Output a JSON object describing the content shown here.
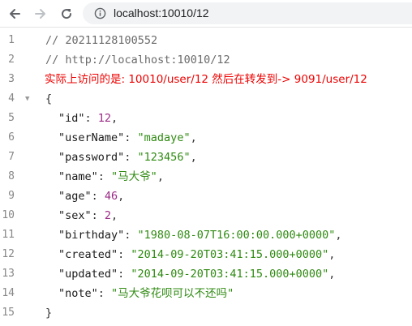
{
  "browser": {
    "url": "localhost:10010/12"
  },
  "code": {
    "line_numbers": [
      "1",
      "2",
      "3",
      "4",
      "5",
      "6",
      "7",
      "8",
      "9",
      "10",
      "11",
      "12",
      "13",
      "14",
      "15"
    ],
    "comment_1": "// 20211128100552",
    "comment_2": "// http://localhost:10010/12",
    "red_note": "实际上访问的是: 10010/user/12 然后在转发到-> 9091/user/12",
    "open_brace": "{",
    "close_brace": "}",
    "fields": [
      {
        "key": "\"id\"",
        "value": "12",
        "type": "number",
        "comma": ","
      },
      {
        "key": "\"userName\"",
        "value": "\"madaye\"",
        "type": "string",
        "comma": ","
      },
      {
        "key": "\"password\"",
        "value": "\"123456\"",
        "type": "string",
        "comma": ","
      },
      {
        "key": "\"name\"",
        "value": "\"马大爷\"",
        "type": "string",
        "comma": ","
      },
      {
        "key": "\"age\"",
        "value": "46",
        "type": "number",
        "comma": ","
      },
      {
        "key": "\"sex\"",
        "value": "2",
        "type": "number",
        "comma": ","
      },
      {
        "key": "\"birthday\"",
        "value": "\"1980-08-07T16:00:00.000+0000\"",
        "type": "string",
        "comma": ","
      },
      {
        "key": "\"created\"",
        "value": "\"2014-09-20T03:41:15.000+0000\"",
        "type": "string",
        "comma": ","
      },
      {
        "key": "\"updated\"",
        "value": "\"2014-09-20T03:41:15.000+0000\"",
        "type": "string",
        "comma": ","
      },
      {
        "key": "\"note\"",
        "value": "\"马大爷花呗可以不还吗\"",
        "type": "string",
        "comma": ""
      }
    ],
    "colon": ": "
  },
  "colors": {
    "comment": "#6b6b6b",
    "note_red": "#ee0000",
    "string": "#2f8a11",
    "number": "#9b2a86"
  },
  "icons": {
    "back": "arrow-left-icon",
    "forward": "arrow-right-icon",
    "reload": "reload-icon",
    "info": "info-icon",
    "fold": "fold-caret-icon"
  }
}
